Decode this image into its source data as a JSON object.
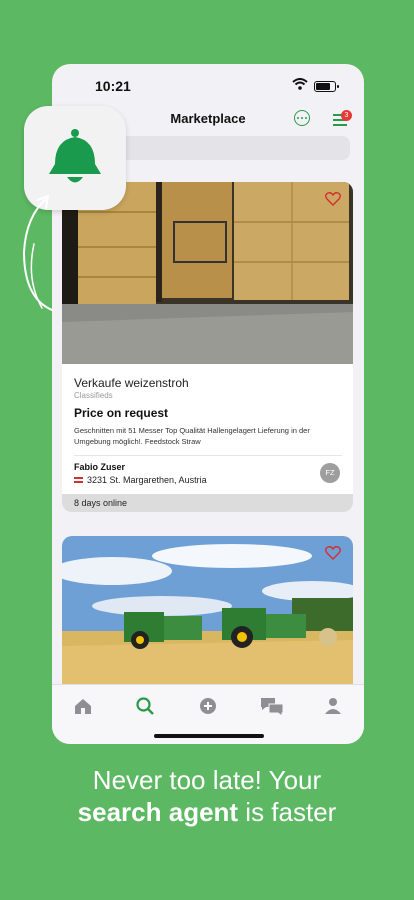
{
  "status_bar": {
    "time": "10:21"
  },
  "header": {
    "title": "Marketplace",
    "filter_badge": "3"
  },
  "listings": [
    {
      "title": "Verkaufe weizenstroh",
      "category": "Classifieds",
      "price": "Price on request",
      "description": "Geschnitten mit 51 Messer Top Qualität Hallengelagert Lieferung in der Umgebung möglich!. Feedstock Straw",
      "seller_name": "Fabio Zuser",
      "seller_location": "3231 St. Margarethen, Austria",
      "seller_initials": "FZ",
      "online_since": "8 days online"
    },
    {}
  ],
  "tab_bar": {
    "items": [
      "home-icon",
      "search-icon",
      "add-icon",
      "chat-icon",
      "profile-icon"
    ],
    "active": "search-icon"
  },
  "promo": {
    "line1": "Never too late! Your",
    "line2_bold": "search agent",
    "line2_rest": " is faster"
  },
  "colors": {
    "background": "#5db863",
    "accent": "#2a9a48",
    "badge": "#e53935",
    "heart": "#d32f2f"
  }
}
